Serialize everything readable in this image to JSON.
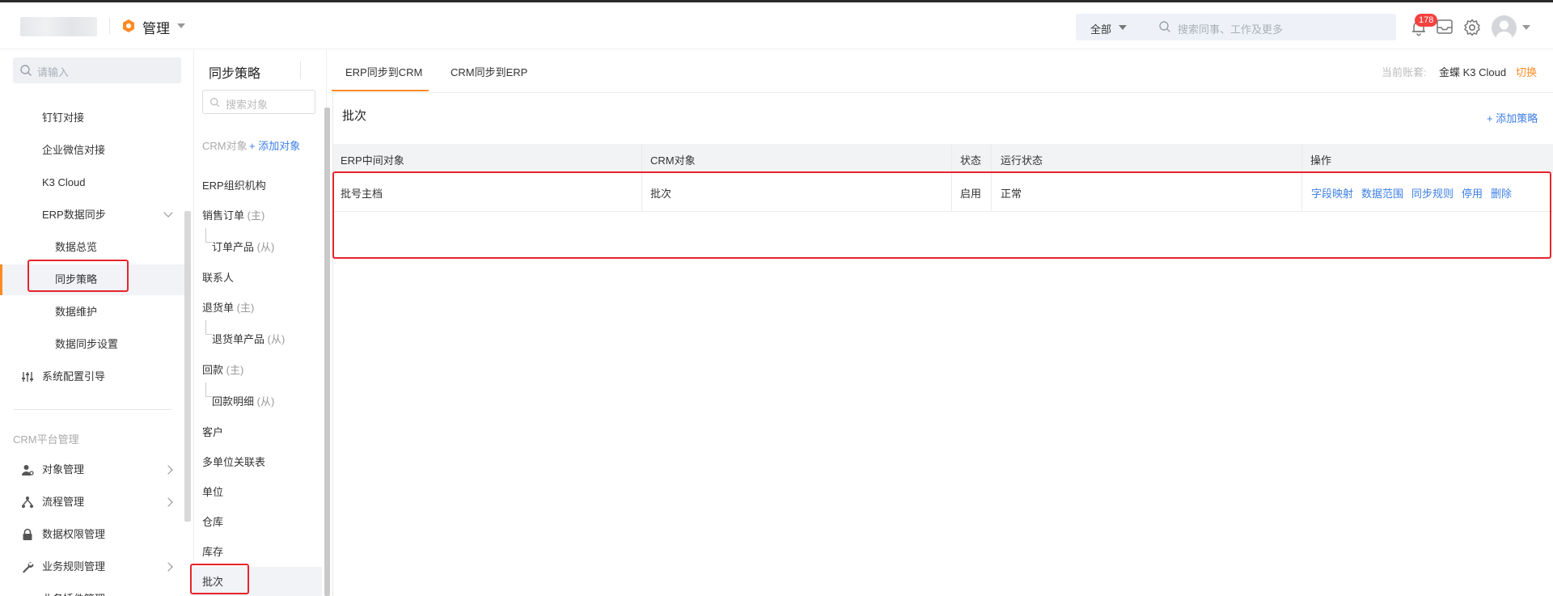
{
  "header": {
    "app_title": "管理",
    "search_scope": "全部",
    "search_placeholder": "搜索同事、工作及更多",
    "notification_count": "178",
    "colors": {
      "accent": "#ff8a24",
      "badge": "#f5413f",
      "link": "#3d7fe6"
    }
  },
  "sidebar": {
    "search_placeholder": "请输入",
    "items": [
      {
        "label": "钉钉对接"
      },
      {
        "label": "企业微信对接"
      },
      {
        "label": "K3 Cloud"
      },
      {
        "label": "ERP数据同步"
      },
      {
        "label": "数据总览"
      },
      {
        "label": "同步策略"
      },
      {
        "label": "数据维护"
      },
      {
        "label": "数据同步设置"
      },
      {
        "label": "系统配置引导"
      }
    ],
    "group_label": "CRM平台管理",
    "group_items": [
      {
        "label": "对象管理"
      },
      {
        "label": "流程管理"
      },
      {
        "label": "数据权限管理"
      },
      {
        "label": "业务规则管理"
      },
      {
        "label": "业务插件管理"
      }
    ]
  },
  "object_panel": {
    "title": "同步策略",
    "search_placeholder": "搜索对象",
    "crm_label": "CRM对象",
    "add_label": "+ 添加对象",
    "items": [
      {
        "label": "ERP组织机构"
      },
      {
        "label": "销售订单",
        "tag": "(主)"
      },
      {
        "label": "订单产品",
        "tag": "(从)"
      },
      {
        "label": "联系人"
      },
      {
        "label": "退货单",
        "tag": "(主)"
      },
      {
        "label": "退货单产品",
        "tag": "(从)"
      },
      {
        "label": "回款",
        "tag": "(主)"
      },
      {
        "label": "回款明细",
        "tag": "(从)"
      },
      {
        "label": "客户"
      },
      {
        "label": "多单位关联表"
      },
      {
        "label": "单位"
      },
      {
        "label": "仓库"
      },
      {
        "label": "库存"
      },
      {
        "label": "批次"
      }
    ]
  },
  "main": {
    "tabs": [
      {
        "label": "ERP同步到CRM"
      },
      {
        "label": "CRM同步到ERP"
      }
    ],
    "account_label": "当前账套:",
    "account_name": "金蝶 K3 Cloud",
    "switch_label": "切换",
    "section_title": "批次",
    "add_policy_label": "+ 添加策略",
    "table": {
      "headers": [
        "ERP中间对象",
        "CRM对象",
        "状态",
        "运行状态",
        "操作"
      ],
      "rows": [
        {
          "erp_object": "批号主档",
          "crm_object": "批次",
          "status": "启用",
          "run_status": "正常",
          "actions": [
            "字段映射",
            "数据范围",
            "同步规则",
            "停用",
            "删除"
          ]
        }
      ]
    }
  }
}
